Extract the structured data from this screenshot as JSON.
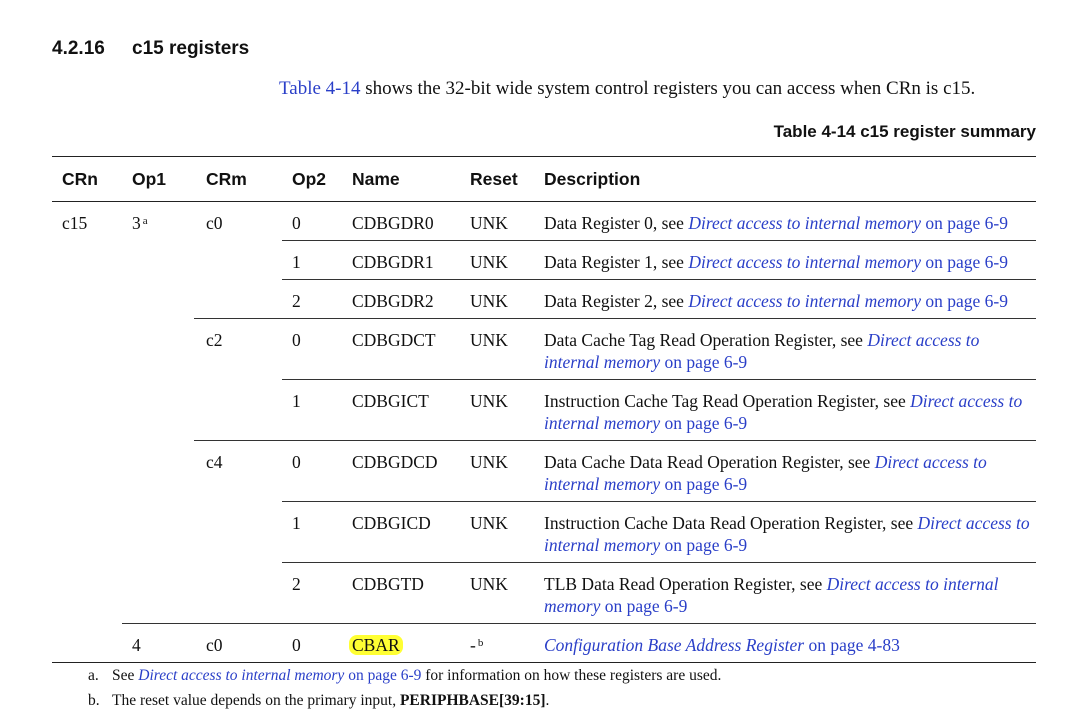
{
  "section": {
    "number": "4.2.16",
    "title": "c15 registers"
  },
  "intro": {
    "link": "Table 4-14",
    "text": " shows the 32-bit wide system control registers you can access when CRn is c15."
  },
  "caption": "Table 4-14 c15 register summary",
  "columns": [
    "CRn",
    "Op1",
    "CRm",
    "Op2",
    "Name",
    "Reset",
    "Description"
  ],
  "rows": [
    {
      "crn": "c15",
      "op1": "3",
      "op1_sup": "a",
      "crm": "c0",
      "op2": "0",
      "name": "CDBGDR0",
      "reset": "UNK",
      "desc_pre": "Data Register 0, see ",
      "desc_link": "Direct access to internal memory",
      "desc_page": " on page 6-9"
    },
    {
      "op2": "1",
      "name": "CDBGDR1",
      "reset": "UNK",
      "desc_pre": "Data Register 1, see ",
      "desc_link": "Direct access to internal memory",
      "desc_page": " on page 6-9"
    },
    {
      "op2": "2",
      "name": "CDBGDR2",
      "reset": "UNK",
      "desc_pre": "Data Register 2, see ",
      "desc_link": "Direct access to internal memory",
      "desc_page": " on page 6-9"
    },
    {
      "crm": "c2",
      "op2": "0",
      "name": "CDBGDCT",
      "reset": "UNK",
      "desc_pre": "Data Cache Tag Read Operation Register, see ",
      "desc_link": "Direct access to internal memory",
      "desc_page": " on page 6-9"
    },
    {
      "op2": "1",
      "name": "CDBGICT",
      "reset": "UNK",
      "desc_pre": "Instruction Cache Tag Read Operation Register, see ",
      "desc_link": "Direct access to internal memory",
      "desc_page": " on page 6-9"
    },
    {
      "crm": "c4",
      "op2": "0",
      "name": "CDBGDCD",
      "reset": "UNK",
      "desc_pre": "Data Cache Data Read Operation Register, see ",
      "desc_link": "Direct access to internal memory",
      "desc_page": " on page 6-9"
    },
    {
      "op2": "1",
      "name": "CDBGICD",
      "reset": "UNK",
      "desc_pre": "Instruction Cache Data Read Operation Register, see ",
      "desc_link": "Direct access to internal memory",
      "desc_page": " on page 6-9"
    },
    {
      "op2": "2",
      "name": "CDBGTD",
      "reset": "UNK",
      "desc_pre": "TLB Data Read Operation Register, see ",
      "desc_link": "Direct access to internal memory",
      "desc_page": " on page 6-9"
    },
    {
      "op1": "4",
      "crm": "c0",
      "op2": "0",
      "name": "CBAR",
      "reset": "-",
      "reset_sup": "b",
      "desc_pre": "",
      "desc_link": "Configuration Base Address Register",
      "desc_page": " on page 4-83"
    }
  ],
  "footnotes": {
    "a": {
      "label": "a.",
      "pre": "See ",
      "link": "Direct access to internal memory",
      "page": " on page 6-9",
      "post": " for information on how these registers are used."
    },
    "b": {
      "label": "b.",
      "pre": "The reset value depends on the primary input, ",
      "bold": "PERIPHBASE[39:15]",
      "post": "."
    }
  },
  "colors": {
    "link": "#2a3fc8",
    "highlight": "#ffff33"
  }
}
